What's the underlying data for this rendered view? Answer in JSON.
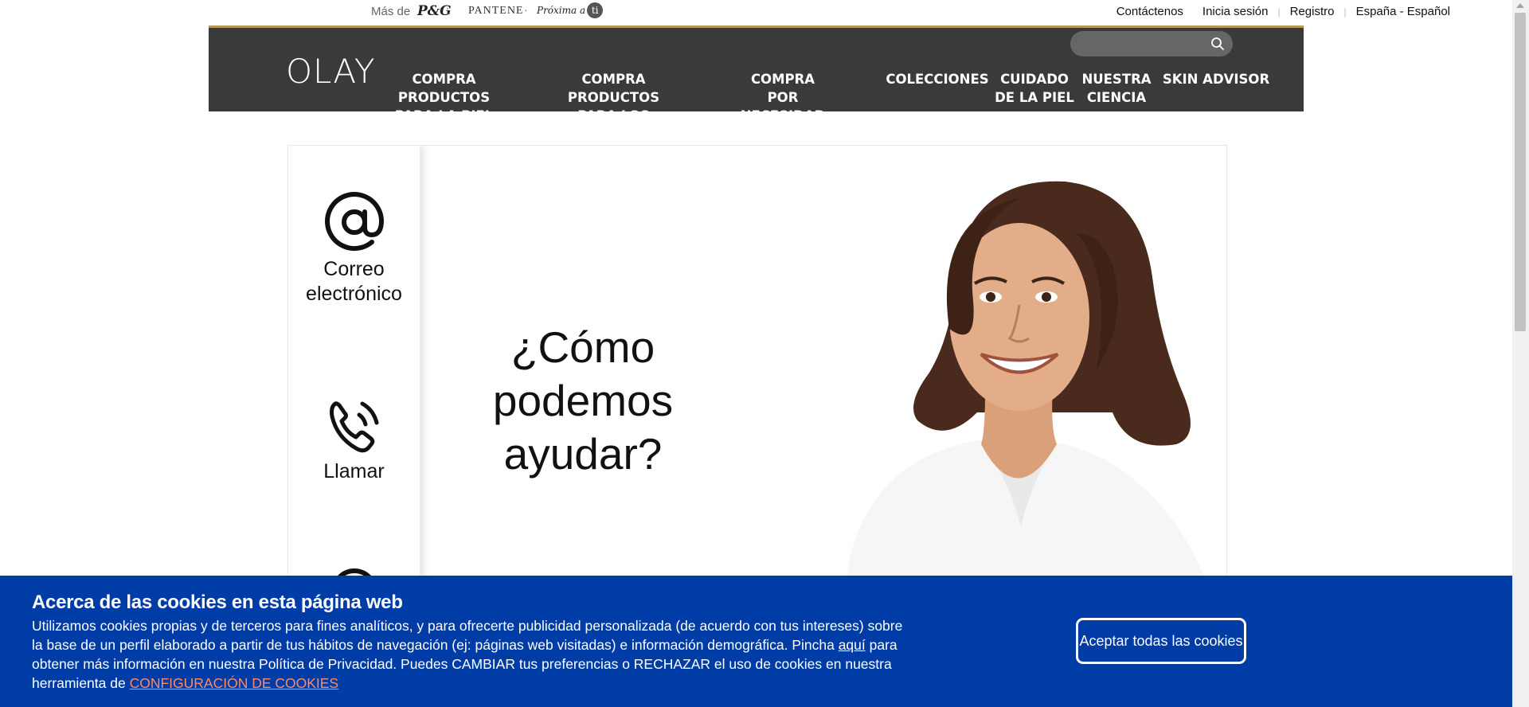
{
  "topbar": {
    "mas_de": "Más de",
    "pg_logo": "P&G",
    "colon": ":",
    "pantene": "PANTENE",
    "dot": "·",
    "proxima": "Próxima a",
    "proxima_ti": "ti"
  },
  "toplinks": {
    "contact": "Contáctenos",
    "login": "Inicia sesión",
    "register": "Registro",
    "locale": "España - Español"
  },
  "nav": {
    "logo": "OLAY",
    "search_placeholder": "",
    "items": [
      "COMPRA PRODUCTOS\nPARA LA PIEL",
      "COMPRA PRODUCTOS\nPARA LOS OJOS",
      "COMPRA\nPOR NECESIDAD",
      "COLECCIONES",
      "CUIDADO\nDE LA PIEL",
      "NUESTRA\nCIENCIA",
      "SKIN ADVISOR"
    ]
  },
  "sidebar": {
    "email_label": "Correo\nelectrónico",
    "call_label": "Llamar"
  },
  "main": {
    "headline": "¿Cómo\npodemos\nayudar?"
  },
  "cookie": {
    "title": "Acerca de las cookies en esta página web",
    "body_1": "Utilizamos cookies propias y de terceros para fines analíticos, y para ofrecerte publicidad personalizada (de acuerdo con tus intereses) sobre la base de un perfil elaborado a partir de tus hábitos de navegación (ej: páginas web visitadas) e información demográfica. Pincha ",
    "aqui": "aquí",
    "body_2": " para obtener más información en nuestra Política de Privacidad. Puedes CAMBIAR tus preferencias o RECHAZAR el uso de cookies en nuestra herramienta de ",
    "config_link": "CONFIGURACIÓN DE COOKIES",
    "accept": "Aceptar todas las cookies"
  },
  "colors": {
    "nav_bg": "#3a3a3c",
    "gold_line": "#b59a5b",
    "cookie_bg": "#003ca6",
    "config_link": "#ff8a65"
  }
}
